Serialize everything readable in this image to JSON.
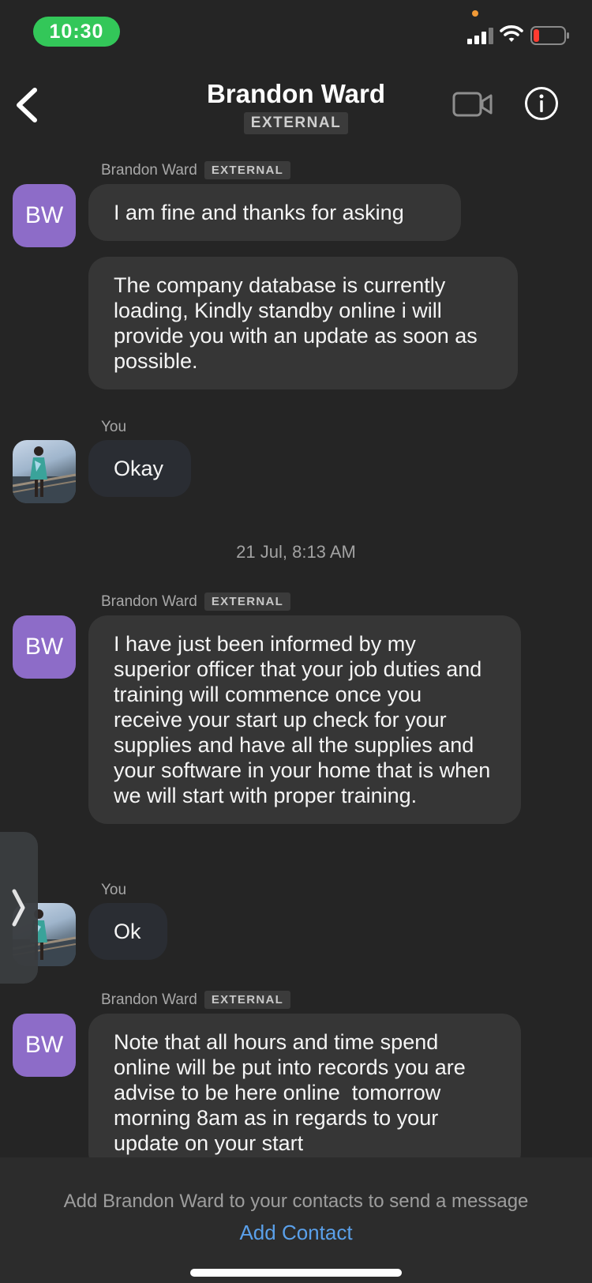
{
  "status_bar": {
    "time": "10:30"
  },
  "header": {
    "name": "Brandon Ward",
    "badge": "EXTERNAL"
  },
  "labels": {
    "you": "You"
  },
  "messages": {
    "m1": {
      "sender": "Brandon Ward",
      "badge": "EXTERNAL",
      "avatar": "BW",
      "text": "I am fine and thanks for asking"
    },
    "m2": {
      "text": "The company database is currently loading, Kindly standby online i will provide you with an update as soon as possible."
    },
    "m3": {
      "sender": "You",
      "text": "Okay"
    },
    "timestamp": "21 Jul, 8:13 AM",
    "m4": {
      "sender": "Brandon Ward",
      "badge": "EXTERNAL",
      "avatar": "BW",
      "text": "I have just been informed by my superior officer that your job duties and training will commence once you receive your start up check for your supplies and have all the supplies and your software in your home that is when we will start with proper training."
    },
    "m5": {
      "sender": "You",
      "text": "Ok"
    },
    "m6": {
      "sender": "Brandon Ward",
      "badge": "EXTERNAL",
      "avatar": "BW",
      "text": "Note that all hours and time spend online will be put into records you are advise to be here online  tomorrow morning 8am as in regards to your update on your start"
    }
  },
  "footer": {
    "notice": "Add Brandon Ward to your contacts to send a message",
    "action": "Add Contact"
  },
  "colors": {
    "accent": "#5aa0ea",
    "avatar_bg": "#8d6cc8",
    "time_pill": "#33c759"
  }
}
